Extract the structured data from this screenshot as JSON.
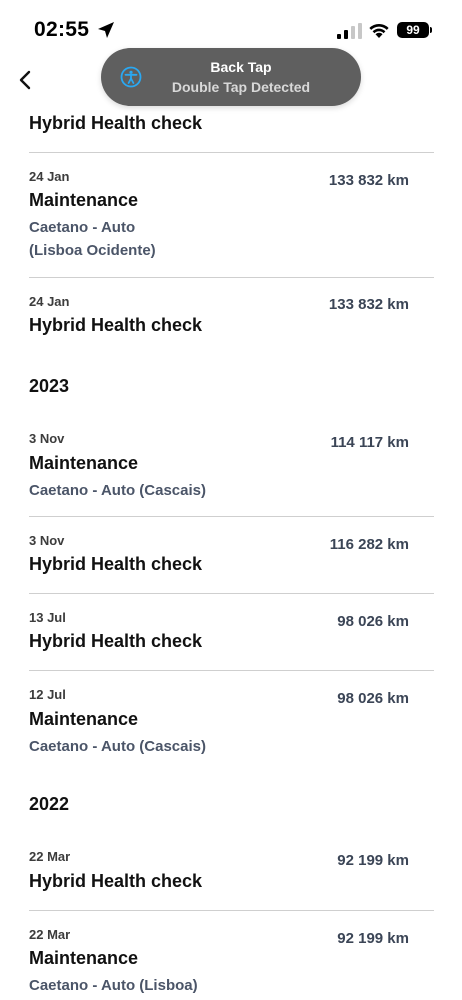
{
  "status_bar": {
    "time": "02:55",
    "battery": "99",
    "location_icon": "location-arrow-icon",
    "signal_icon": "cellular-signal-icon",
    "wifi_icon": "wifi-icon"
  },
  "nav": {
    "back_icon": "chevron-left-icon"
  },
  "toast": {
    "icon": "accessibility-icon",
    "title": "Back Tap",
    "subtitle": "Double Tap Detected",
    "accent": "#2aa8f2"
  },
  "top_record_title": "Hybrid Health check",
  "records_2024": [
    {
      "date": "24 Jan",
      "title": "Maintenance",
      "km": "133 832 km",
      "place_line1": "Caetano - Auto",
      "place_line2": "(Lisboa Ocidente)"
    },
    {
      "date": "24 Jan",
      "title": "Hybrid Health check",
      "km": "133 832 km"
    }
  ],
  "year_2023": "2023",
  "records_2023": [
    {
      "date": "3 Nov",
      "title": "Maintenance",
      "km": "114 117 km",
      "place": "Caetano - Auto (Cascais)"
    },
    {
      "date": "3 Nov",
      "title": "Hybrid Health check",
      "km": "116 282 km"
    },
    {
      "date": "13 Jul",
      "title": "Hybrid Health check",
      "km": "98 026 km"
    },
    {
      "date": "12 Jul",
      "title": "Maintenance",
      "km": "98 026 km",
      "place": "Caetano - Auto (Cascais)"
    }
  ],
  "year_2022": "2022",
  "records_2022": [
    {
      "date": "22 Mar",
      "title": "Hybrid Health check",
      "km": "92 199 km"
    },
    {
      "date": "22 Mar",
      "title": "Maintenance",
      "km": "92 199 km",
      "place": "Caetano - Auto (Lisboa)"
    }
  ],
  "colors": {
    "km_text": "#3b4556",
    "place_text": "#4b5568",
    "divider": "#cfcfcf",
    "toast_bg": "#5f5f5f"
  }
}
